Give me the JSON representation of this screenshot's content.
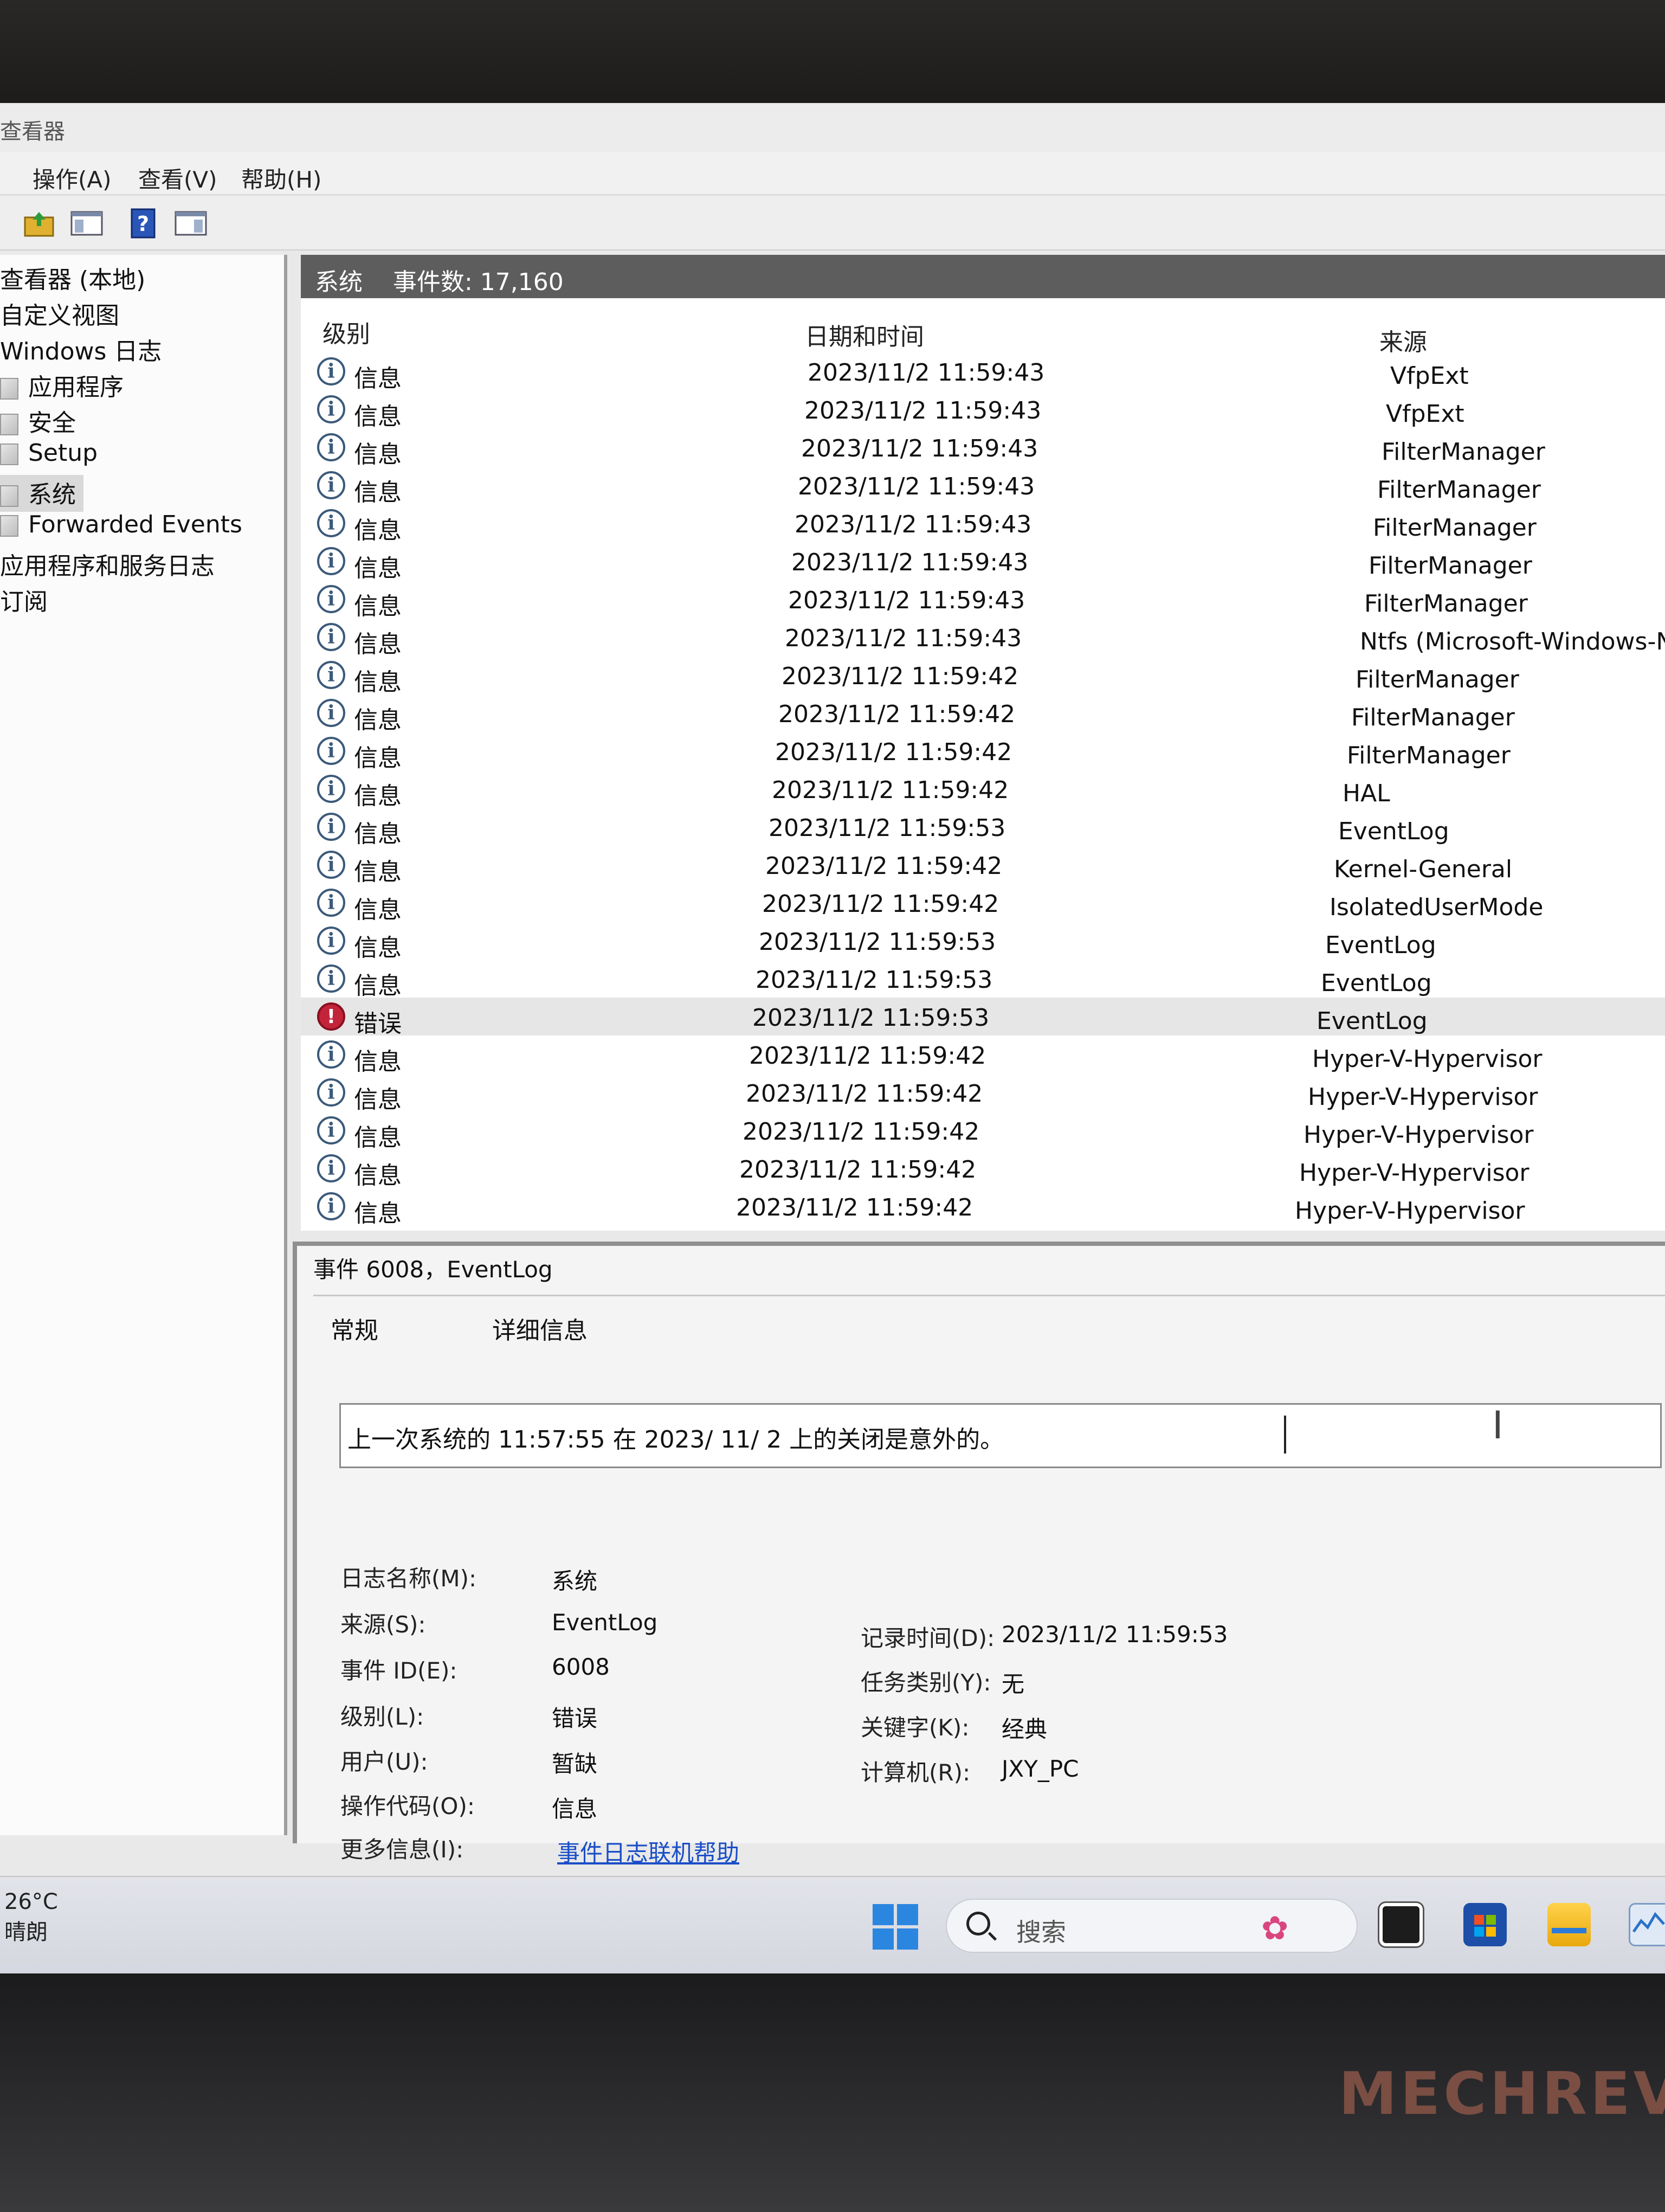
{
  "window": {
    "title": "查看器"
  },
  "menu": [
    "操作(A)",
    "查看(V)",
    "帮助(H)"
  ],
  "toolbar_icons": [
    "folder-up-icon",
    "console-tree-icon",
    "help-icon",
    "action-pane-icon"
  ],
  "tree": {
    "items": [
      {
        "label": "查看器 (本地)"
      },
      {
        "label": "自定义视图"
      },
      {
        "label": "Windows 日志"
      },
      {
        "label": "应用程序"
      },
      {
        "label": "安全"
      },
      {
        "label": "Setup"
      },
      {
        "label": "系统",
        "selected": true
      },
      {
        "label": "Forwarded Events"
      },
      {
        "label": "应用程序和服务日志"
      },
      {
        "label": "订阅"
      }
    ]
  },
  "list": {
    "log_name": "系统",
    "event_count": "事件数: 17,160",
    "columns": {
      "level": "级别",
      "datetime": "日期和时间",
      "source": "来源"
    },
    "rows": [
      {
        "level": "信息",
        "datetime": "2023/11/2 11:59:43",
        "source": "VfpExt"
      },
      {
        "level": "信息",
        "datetime": "2023/11/2 11:59:43",
        "source": "VfpExt"
      },
      {
        "level": "信息",
        "datetime": "2023/11/2 11:59:43",
        "source": "FilterManager"
      },
      {
        "level": "信息",
        "datetime": "2023/11/2 11:59:43",
        "source": "FilterManager"
      },
      {
        "level": "信息",
        "datetime": "2023/11/2 11:59:43",
        "source": "FilterManager"
      },
      {
        "level": "信息",
        "datetime": "2023/11/2 11:59:43",
        "source": "FilterManager"
      },
      {
        "level": "信息",
        "datetime": "2023/11/2 11:59:43",
        "source": "FilterManager"
      },
      {
        "level": "信息",
        "datetime": "2023/11/2 11:59:43",
        "source": "Ntfs (Microsoft-Windows-N"
      },
      {
        "level": "信息",
        "datetime": "2023/11/2 11:59:42",
        "source": "FilterManager"
      },
      {
        "level": "信息",
        "datetime": "2023/11/2 11:59:42",
        "source": "FilterManager"
      },
      {
        "level": "信息",
        "datetime": "2023/11/2 11:59:42",
        "source": "FilterManager"
      },
      {
        "level": "信息",
        "datetime": "2023/11/2 11:59:42",
        "source": "HAL"
      },
      {
        "level": "信息",
        "datetime": "2023/11/2 11:59:53",
        "source": "EventLog"
      },
      {
        "level": "信息",
        "datetime": "2023/11/2 11:59:42",
        "source": "Kernel-General"
      },
      {
        "level": "信息",
        "datetime": "2023/11/2 11:59:42",
        "source": "IsolatedUserMode"
      },
      {
        "level": "信息",
        "datetime": "2023/11/2 11:59:53",
        "source": "EventLog"
      },
      {
        "level": "信息",
        "datetime": "2023/11/2 11:59:53",
        "source": "EventLog"
      },
      {
        "level": "错误",
        "datetime": "2023/11/2 11:59:53",
        "source": "EventLog",
        "selected": true,
        "error": true
      },
      {
        "level": "信息",
        "datetime": "2023/11/2 11:59:42",
        "source": "Hyper-V-Hypervisor"
      },
      {
        "level": "信息",
        "datetime": "2023/11/2 11:59:42",
        "source": "Hyper-V-Hypervisor"
      },
      {
        "level": "信息",
        "datetime": "2023/11/2 11:59:42",
        "source": "Hyper-V-Hypervisor"
      },
      {
        "level": "信息",
        "datetime": "2023/11/2 11:59:42",
        "source": "Hyper-V-Hypervisor"
      },
      {
        "level": "信息",
        "datetime": "2023/11/2 11:59:42",
        "source": "Hyper-V-Hypervisor"
      }
    ]
  },
  "detail": {
    "title": "事件 6008，EventLog",
    "tabs": [
      "常规",
      "详细信息"
    ],
    "message": "上一次系统的 11:57:55 在  2023/ 11/ 2 上的关闭是意外的。",
    "fields_left": [
      {
        "label": "日志名称(M):",
        "value": "系统"
      },
      {
        "label": "来源(S):",
        "value": "EventLog"
      },
      {
        "label": "事件 ID(E):",
        "value": "6008"
      },
      {
        "label": "级别(L):",
        "value": "错误"
      },
      {
        "label": "用户(U):",
        "value": "暂缺"
      },
      {
        "label": "操作代码(O):",
        "value": "信息"
      },
      {
        "label": "更多信息(I):",
        "value": "事件日志联机帮助",
        "link": true
      }
    ],
    "fields_right": [
      {
        "label": "记录时间(D):",
        "value": "2023/11/2 11:59:53"
      },
      {
        "label": "任务类别(Y):",
        "value": "无"
      },
      {
        "label": "关键字(K):",
        "value": "经典"
      },
      {
        "label": "计算机(R):",
        "value": "JXY_PC"
      }
    ]
  },
  "taskbar": {
    "temperature": "26°C",
    "weather": "晴朗",
    "search_placeholder": "搜索",
    "apps": [
      "task-view-icon",
      "store-icon",
      "file-explorer-icon",
      "resource-monitor-icon"
    ]
  },
  "device": {
    "brand": "MECHREV"
  }
}
